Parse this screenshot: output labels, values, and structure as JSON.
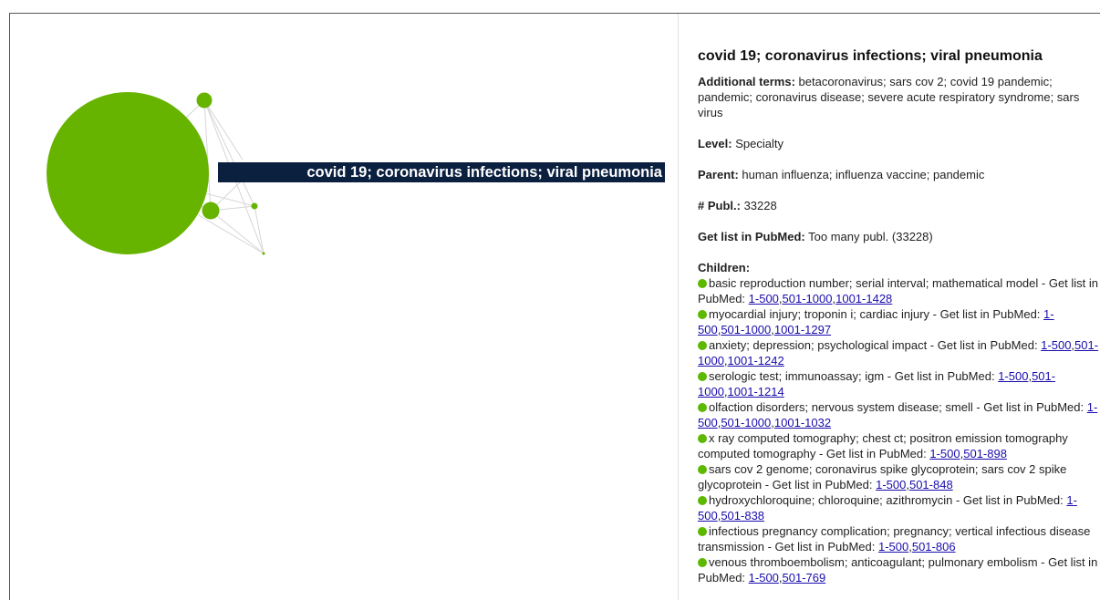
{
  "graph": {
    "label": "covid 19; coronavirus infections; viral pneumonia",
    "colors": {
      "node": "#66b300",
      "label_bg": "#0b1f3f",
      "edge": "#cccccc"
    }
  },
  "details": {
    "title": "covid 19; coronavirus infections; viral pneumonia",
    "additional_terms_key": "Additional terms:",
    "additional_terms": "betacoronavirus; sars cov 2; covid 19 pandemic; pandemic; coronavirus disease; severe acute respiratory syndrome; sars virus",
    "level_key": "Level:",
    "level": "Specialty",
    "parent_key": "Parent:",
    "parent": "human influenza; influenza vaccine; pandemic",
    "publ_key": "# Publ.:",
    "publ": "33228",
    "pubmed_key": "Get list in PubMed:",
    "pubmed": "Too many publ. (33228)",
    "children_key": "Children:",
    "children": [
      {
        "text": "basic reproduction number; serial interval; mathematical model - Get list in PubMed: ",
        "links": [
          "1-500",
          "501-1000",
          "1001-1428"
        ]
      },
      {
        "text": "myocardial injury; troponin i; cardiac injury - Get list in PubMed: ",
        "links": [
          "1-500",
          "501-1000",
          "1001-1297"
        ]
      },
      {
        "text": "anxiety; depression; psychological impact - Get list in PubMed: ",
        "links": [
          "1-500",
          "501-1000",
          "1001-1242"
        ]
      },
      {
        "text": "serologic test; immunoassay; igm - Get list in PubMed: ",
        "links": [
          "1-500",
          "501-1000",
          "1001-1214"
        ]
      },
      {
        "text": "olfaction disorders; nervous system disease; smell - Get list in PubMed: ",
        "links": [
          "1-500",
          "501-1000",
          "1001-1032"
        ]
      },
      {
        "text": "x ray computed tomography; chest ct; positron emission tomography computed tomography - Get list in PubMed: ",
        "links": [
          "1-500",
          "501-898"
        ]
      },
      {
        "text": "sars cov 2 genome; coronavirus spike glycoprotein; sars cov 2 spike glycoprotein - Get list in PubMed: ",
        "links": [
          "1-500",
          "501-848"
        ]
      },
      {
        "text": "hydroxychloroquine; chloroquine; azithromycin - Get list in PubMed: ",
        "links": [
          "1-500",
          "501-838"
        ]
      },
      {
        "text": "infectious pregnancy complication; pregnancy; vertical infectious disease transmission - Get list in PubMed: ",
        "links": [
          "1-500",
          "501-806"
        ]
      },
      {
        "text": "venous thromboembolism; anticoagulant; pulmonary embolism - Get list in PubMed: ",
        "links": [
          "1-500",
          "501-769"
        ]
      }
    ]
  }
}
